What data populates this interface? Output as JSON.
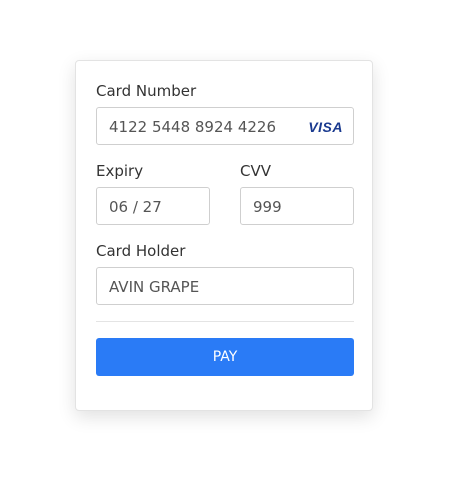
{
  "form": {
    "card_number": {
      "label": "Card Number",
      "value": "4122 5448 8924 4226",
      "brand": "VISA"
    },
    "expiry": {
      "label": "Expiry",
      "value": "06 / 27"
    },
    "cvv": {
      "label": "CVV",
      "value": "999"
    },
    "card_holder": {
      "label": "Card Holder",
      "value": "AVIN GRAPE"
    },
    "pay_button": {
      "label": "PAY"
    }
  },
  "colors": {
    "accent": "#2a7bf6",
    "visa_brand": "#1a3a8f",
    "border": "#cfcfcf"
  }
}
